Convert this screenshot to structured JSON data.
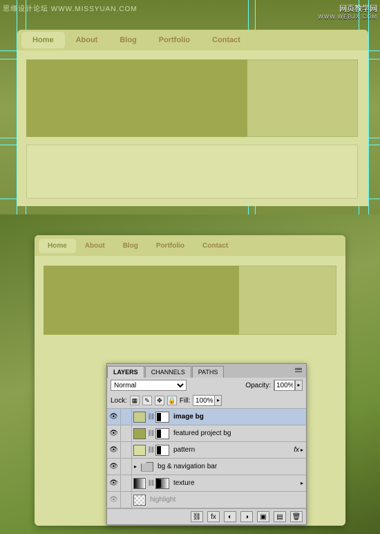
{
  "watermark": {
    "left": "思缘设计论坛 WWW.MISSYUAN.COM",
    "right_main": "网页教学网",
    "right_sub": "WWW.WEBJX.COM"
  },
  "nav": {
    "items": [
      "Home",
      "About",
      "Blog",
      "Portfolio",
      "Contact"
    ],
    "active": "Home"
  },
  "layers_panel": {
    "tabs": [
      "LAYERS",
      "CHANNELS",
      "PATHS"
    ],
    "active_tab": "LAYERS",
    "blend_mode": "Normal",
    "opacity_label": "Opacity:",
    "opacity_value": "100%",
    "lock_label": "Lock:",
    "fill_label": "Fill:",
    "fill_value": "100%",
    "layers": [
      {
        "name": "image bg",
        "swatch": "#c8ce8a",
        "selected": true,
        "has_mask": true
      },
      {
        "name": "featured project bg",
        "swatch": "#a0a84f",
        "has_mask": true
      },
      {
        "name": "pattern",
        "swatch": "#d9dfa0",
        "has_mask": true,
        "fx": true
      },
      {
        "name": "bg & navigation bar",
        "type": "group"
      },
      {
        "name": "texture",
        "type": "gradient",
        "has_mask": true
      },
      {
        "name": "highlight",
        "type": "transparent",
        "dim": true
      }
    ],
    "fx_label": "fx"
  }
}
